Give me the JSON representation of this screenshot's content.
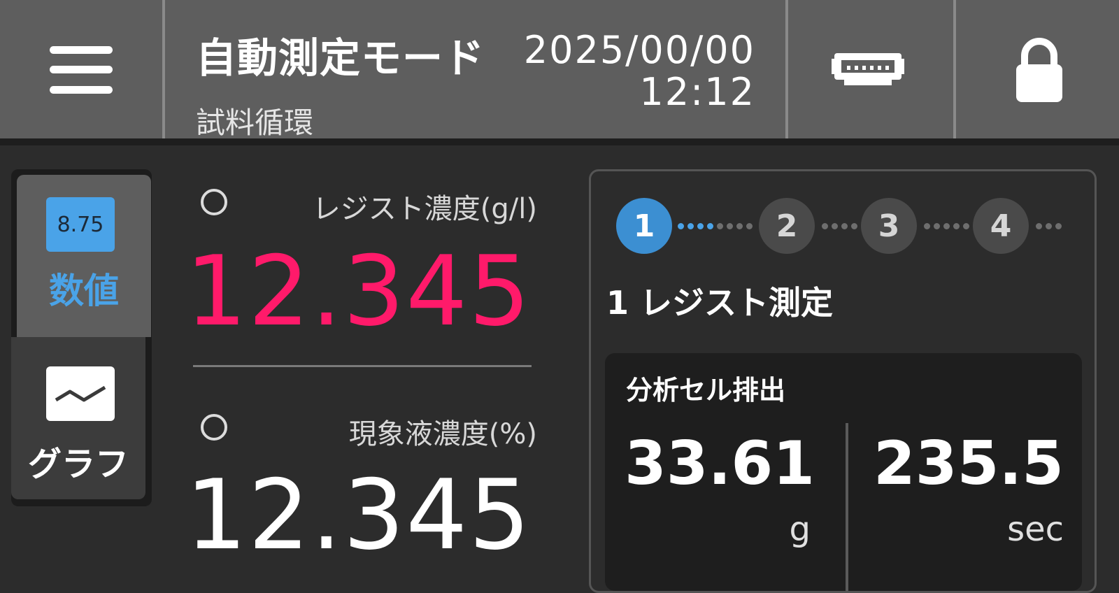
{
  "header": {
    "mode_title": "自動測定モード",
    "mode_subtitle": "試料循環",
    "date": "2025/00/00",
    "time": "12:12"
  },
  "nav": {
    "numeric_tab": {
      "icon_value": "8.75",
      "label": "数値"
    },
    "graph_tab": {
      "label": "グラフ"
    }
  },
  "measurements": [
    {
      "label": "レジスト濃度(g/l)",
      "value": "12.345",
      "color": "#ff1a6a"
    },
    {
      "label": "現象液濃度(%)",
      "value": "12.345",
      "color": "#ffffff"
    }
  ],
  "steps": {
    "items": [
      "1",
      "2",
      "3",
      "4"
    ],
    "current_index": 0,
    "title": "1 レジスト測定"
  },
  "step_detail": {
    "title": "分析セル排出",
    "readings": [
      {
        "value": "33.61",
        "unit": "g"
      },
      {
        "value": "235.5",
        "unit": "sec"
      }
    ]
  },
  "colors": {
    "accent": "#4aa3e8",
    "alert_value": "#ff1a6a",
    "header_bg": "#5e5e5e",
    "body_bg": "#2c2c2c"
  },
  "icons": [
    "menu-icon",
    "connection-icon",
    "lock-icon",
    "numeric-icon",
    "graph-icon"
  ]
}
